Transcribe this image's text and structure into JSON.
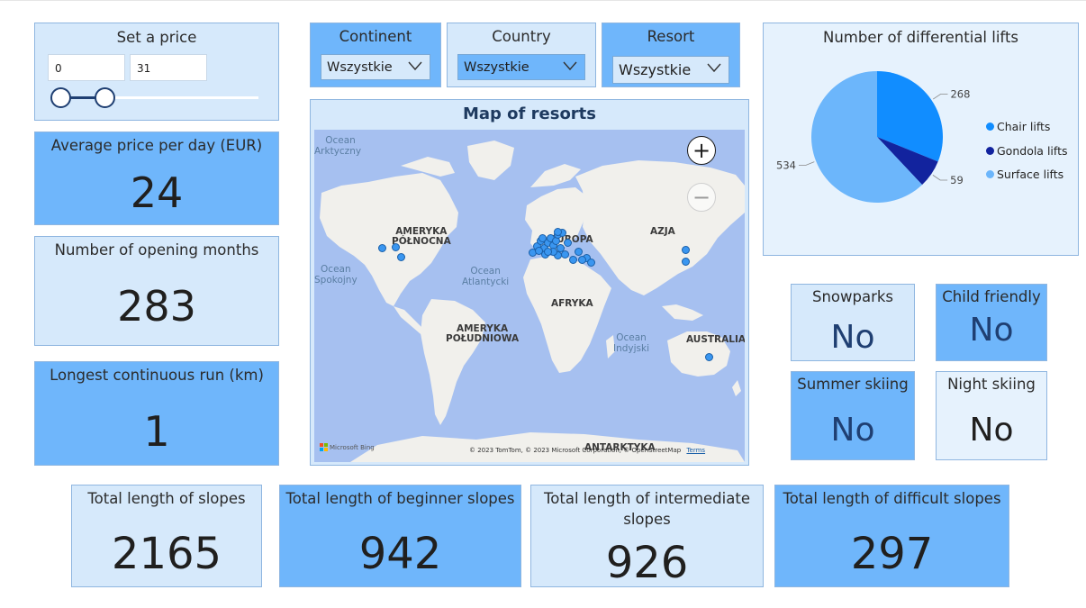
{
  "price_slicer": {
    "title": "Set a price",
    "min_value": "0",
    "max_value": "31"
  },
  "filters": [
    {
      "label": "Continent",
      "selected": "Wszystkie"
    },
    {
      "label": "Country",
      "selected": "Wszystkie"
    },
    {
      "label": "Resort",
      "selected": "Wszystkie"
    }
  ],
  "kpis": {
    "avg_price": {
      "label": "Average price per day (EUR)",
      "value": "24"
    },
    "opening_months": {
      "label": "Number of opening months",
      "value": "283"
    },
    "longest_run": {
      "label": "Longest continuous run (km)",
      "value": "1"
    },
    "total_slopes": {
      "label": "Total length of slopes",
      "value": "2165"
    },
    "beginner_slopes": {
      "label": "Total length of beginner slopes",
      "value": "942"
    },
    "intermediate_slopes": {
      "label_line1": "Total length of intermediate",
      "label_line2": "slopes",
      "value": "926"
    },
    "difficult_slopes": {
      "label": "Total length of difficult slopes",
      "value": "297"
    }
  },
  "flags": {
    "snowparks": {
      "label": "Snowparks",
      "value": "No"
    },
    "child_friendly": {
      "label": "Child friendly",
      "value": "No"
    },
    "summer_skiing": {
      "label": "Summer skiing",
      "value": "No"
    },
    "night_skiing": {
      "label": "Night skiing",
      "value": "No"
    }
  },
  "map": {
    "title": "Map of resorts",
    "continents": {
      "north_america_1": "AMERYKA",
      "north_america_2": "PÓŁNOCNA",
      "south_america_1": "AMERYKA",
      "south_america_2": "POŁUDNIOWA",
      "europe": "EUROPA",
      "asia": "AZJA",
      "africa": "AFRYKA",
      "australia": "AUSTRALIA",
      "antarctica": "ANTARKTYKA"
    },
    "oceans": {
      "arctic_1": "Ocean",
      "arctic_2": "Arktyczny",
      "pacific_1": "Ocean",
      "pacific_2": "Spokojny",
      "atlantic_1": "Ocean",
      "atlantic_2": "Atlantycki",
      "indian_1": "Ocean",
      "indian_2": "Indyjski"
    },
    "attribution": "© 2023 TomTom, © 2023 Microsoft Corporation, © OpenStreetMap",
    "terms": "Terms",
    "logo_text": "Microsoft Bing",
    "zoom_in": "+",
    "zoom_out": "−"
  },
  "lifts_chart": {
    "title": "Number of differential lifts",
    "chart_data": {
      "type": "pie",
      "categories": [
        "Chair lifts",
        "Gondola lifts",
        "Surface lifts"
      ],
      "values": [
        268,
        59,
        534
      ],
      "colors": [
        "#118dff",
        "#12239e",
        "#6cb6fb"
      ],
      "data_labels": [
        "268",
        "59",
        "534"
      ],
      "legend": "right"
    }
  }
}
